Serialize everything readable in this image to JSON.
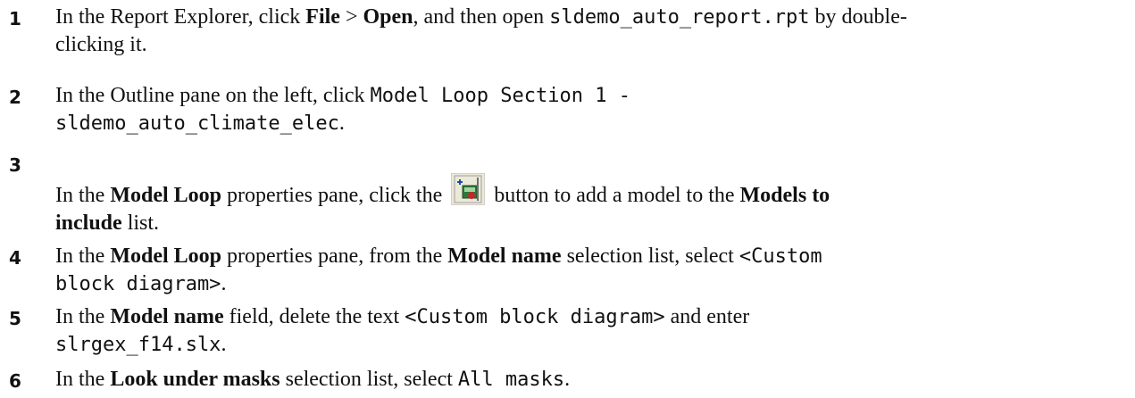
{
  "steps": [
    {
      "number": "1",
      "t1": "In the Report Explorer, click ",
      "b1": "File",
      "t2": " > ",
      "b2": "Open",
      "t3": ", and then open ",
      "c1": "sldemo_auto_report.rpt",
      "t4": " by double-",
      "line2": "clicking it."
    },
    {
      "number": "2",
      "t1": "In the Outline pane on the left, click ",
      "c1": "Model Loop Section 1 -",
      "c2": "sldemo_auto_climate_elec",
      "t2": "."
    },
    {
      "number": "3",
      "t1": "In the ",
      "b1": "Model Loop",
      "t2": " properties pane, click the ",
      "t3": " button to add a model to the ",
      "b2": "Models to",
      "b3": "include",
      "t4": " list."
    },
    {
      "number": "4",
      "t1": "In the ",
      "b1": "Model Loop",
      "t2": " properties pane, from the ",
      "b2": "Model name",
      "t3": " selection list, select ",
      "c1": "<Custom",
      "c2": "block diagram>",
      "t4": "."
    },
    {
      "number": "5",
      "t1": "In the ",
      "b1": "Model name",
      "t2": " field, delete the text ",
      "c1": "<Custom block diagram>",
      "t3": " and enter",
      "c2": "slrgex_f14.slx",
      "t4": "."
    },
    {
      "number": "6",
      "t1": "In the ",
      "b1": "Look under masks",
      "t2": " selection list, select ",
      "c1": "All masks",
      "t3": "."
    }
  ],
  "icons": {
    "add_model_button": "add-model-toolbar-icon"
  }
}
